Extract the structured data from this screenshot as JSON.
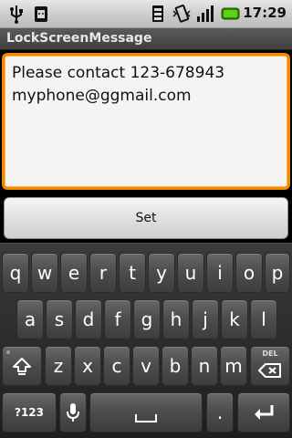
{
  "status_bar": {
    "time": "17:29",
    "icons": [
      "usb-icon",
      "android-icon",
      "sim-icon",
      "vibrate-icon",
      "signal-icon",
      "battery-icon"
    ]
  },
  "app": {
    "title": "LockScreenMessage"
  },
  "message": {
    "value": "Please contact 123-678943\nmyphone@ggmail.com"
  },
  "set_button": {
    "label": "Set"
  },
  "keyboard": {
    "row1": [
      "q",
      "w",
      "e",
      "r",
      "t",
      "y",
      "u",
      "i",
      "o",
      "p"
    ],
    "row2": [
      "a",
      "s",
      "d",
      "f",
      "g",
      "h",
      "j",
      "k",
      "l"
    ],
    "row3": [
      "z",
      "x",
      "c",
      "v",
      "b",
      "n",
      "m"
    ],
    "symbols_label": "?123",
    "period_label": ".",
    "delete_label": "DEL"
  },
  "colors": {
    "focus_border": "#f08a00",
    "keyboard_bg": "#2a2a2a"
  }
}
